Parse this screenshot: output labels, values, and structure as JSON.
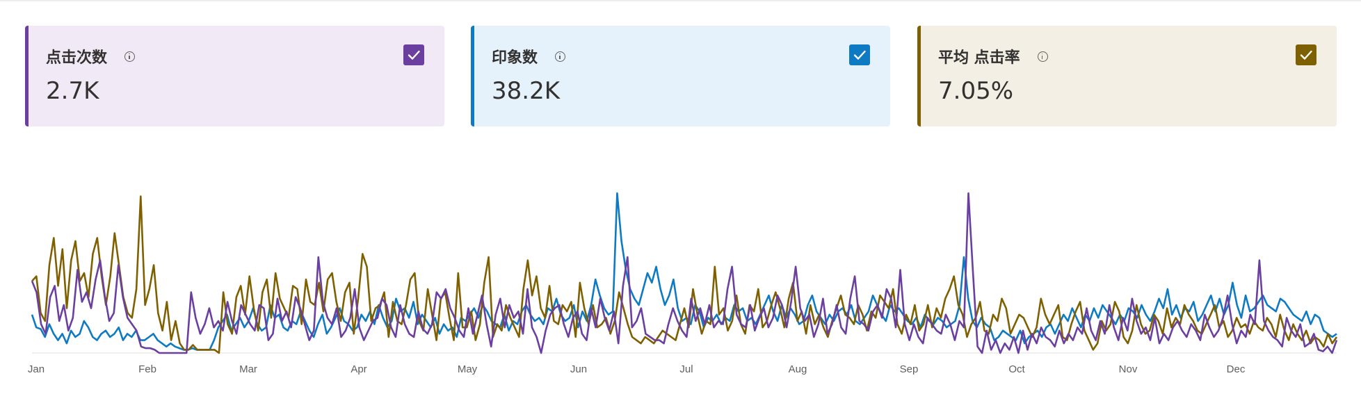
{
  "cards": [
    {
      "title": "点击次数",
      "value": "2.7K",
      "color": "#6b3fa0",
      "bg": "#f1eaf6",
      "icon": "info-icon",
      "checked": true
    },
    {
      "title": "印象数",
      "value": "38.2K",
      "color": "#0e7ac4",
      "bg": "#e6f2fb",
      "icon": "info-icon",
      "checked": true
    },
    {
      "title": "平均 点击率",
      "value": "7.05%",
      "color": "#7f6000",
      "bg": "#f3efe4",
      "icon": "info-icon",
      "checked": true
    }
  ],
  "chart_data": {
    "type": "line",
    "x_ticks": [
      "Jan",
      "Feb",
      "Mar",
      "Apr",
      "May",
      "Jun",
      "Jul",
      "Aug",
      "Sep",
      "Oct",
      "Nov",
      "Dec"
    ],
    "ylim": [
      0,
      100
    ],
    "grid": false,
    "series": [
      {
        "name": "点击次数",
        "color": "#6b3fa0",
        "values": [
          45,
          38,
          18,
          12,
          35,
          42,
          20,
          30,
          14,
          22,
          52,
          32,
          38,
          28,
          46,
          58,
          36,
          20,
          25,
          55,
          35,
          22,
          18,
          14,
          4,
          3,
          3,
          2,
          0,
          0,
          0,
          0,
          0,
          0,
          0,
          38,
          22,
          12,
          18,
          28,
          16,
          20,
          14,
          32,
          20,
          12,
          30,
          24,
          18,
          14,
          30,
          28,
          8,
          12,
          34,
          20,
          26,
          16,
          35,
          28,
          18,
          8,
          14,
          60,
          32,
          22,
          18,
          28,
          10,
          14,
          22,
          40,
          16,
          8,
          14,
          20,
          22,
          34,
          30,
          16,
          10,
          30,
          18,
          12,
          10,
          26,
          15,
          12,
          18,
          38,
          34,
          40,
          28,
          22,
          14,
          10,
          28,
          12,
          24,
          36,
          18,
          4,
          24,
          34,
          16,
          30,
          22,
          26,
          12,
          40,
          16,
          10,
          0,
          14,
          24,
          28,
          30,
          18,
          10,
          22,
          26,
          12,
          8,
          28,
          16,
          34,
          22,
          14,
          26,
          6,
          42,
          60,
          16,
          20,
          28,
          12,
          10,
          8,
          8,
          6,
          18,
          28,
          20,
          14,
          10,
          34,
          20,
          28,
          18,
          30,
          16,
          20,
          18,
          40,
          54,
          24,
          18,
          16,
          30,
          14,
          22,
          28,
          16,
          22,
          36,
          30,
          16,
          32,
          54,
          28,
          20,
          24,
          10,
          18,
          34,
          12,
          18,
          30,
          16,
          12,
          34,
          48,
          20,
          18,
          14,
          26,
          30,
          22,
          40,
          34,
          16,
          52,
          18,
          8,
          18,
          10,
          6,
          22,
          18,
          14,
          12,
          24,
          18,
          8,
          20,
          16,
          100,
          50,
          4,
          0,
          14,
          2,
          8,
          0,
          6,
          2,
          10,
          0,
          14,
          2,
          12,
          6,
          16,
          10,
          8,
          4,
          14,
          6,
          12,
          8,
          16,
          12,
          28,
          14,
          8,
          20,
          12,
          30,
          16,
          8,
          22,
          14,
          34,
          20,
          12,
          16,
          8,
          22,
          6,
          12,
          8,
          16,
          20,
          14,
          10,
          18,
          14,
          8,
          24,
          16,
          10,
          14,
          22,
          36,
          18,
          6,
          14,
          10,
          24,
          18,
          58,
          20,
          14,
          10,
          8,
          4,
          22,
          14,
          10,
          18,
          4,
          6,
          12,
          2,
          1,
          4,
          0,
          8
        ]
      },
      {
        "name": "印象数",
        "color": "#0e7ac4",
        "values": [
          24,
          16,
          15,
          10,
          18,
          12,
          8,
          12,
          6,
          14,
          10,
          12,
          20,
          16,
          10,
          8,
          12,
          14,
          10,
          12,
          16,
          8,
          12,
          10,
          14,
          8,
          8,
          10,
          12,
          8,
          6,
          4,
          6,
          4,
          3,
          2,
          2,
          3,
          2,
          2,
          2,
          2,
          8,
          16,
          20,
          24,
          14,
          18,
          22,
          16,
          20,
          28,
          18,
          14,
          16,
          30,
          22,
          24,
          16,
          14,
          20,
          18,
          26,
          20,
          14,
          10,
          18,
          24,
          12,
          16,
          22,
          28,
          20,
          18,
          14,
          16,
          24,
          20,
          26,
          18,
          30,
          22,
          16,
          20,
          34,
          26,
          28,
          22,
          32,
          18,
          24,
          20,
          16,
          22,
          12,
          18,
          14,
          16,
          10,
          22,
          20,
          24,
          28,
          22,
          30,
          26,
          20,
          18,
          16,
          24,
          14,
          20,
          18,
          26,
          30,
          24,
          20,
          22,
          18,
          28,
          26,
          34,
          24,
          20,
          22,
          30,
          16,
          26,
          20,
          30,
          46,
          36,
          28,
          24,
          26,
          100,
          70,
          52,
          40,
          34,
          30,
          40,
          50,
          44,
          54,
          40,
          30,
          36,
          46,
          28,
          20,
          22,
          18,
          30,
          26,
          16,
          22,
          20,
          24,
          18,
          22,
          20,
          30,
          26,
          28,
          20,
          22,
          18,
          24,
          30,
          36,
          26,
          20,
          30,
          22,
          28,
          24,
          18,
          20,
          30,
          36,
          26,
          22,
          18,
          24,
          20,
          26,
          28,
          24,
          30,
          20,
          18,
          22,
          26,
          36,
          30,
          24,
          20,
          30,
          26,
          28,
          24,
          20,
          18,
          22,
          16,
          24,
          20,
          18,
          22,
          20,
          16,
          18,
          20,
          30,
          60,
          34,
          20,
          16,
          22,
          18,
          16,
          8,
          10,
          14,
          12,
          10,
          8,
          14,
          6,
          10,
          12,
          14,
          10,
          16,
          18,
          12,
          18,
          24,
          20,
          28,
          22,
          16,
          24,
          20,
          28,
          22,
          30,
          26,
          22,
          18,
          24,
          20,
          28,
          26,
          22,
          30,
          24,
          20,
          26,
          34,
          28,
          40,
          24,
          30,
          22,
          28,
          26,
          32,
          20,
          24,
          30,
          36,
          26,
          34,
          24,
          30,
          44,
          30,
          22,
          36,
          26,
          28,
          32,
          36,
          30,
          28,
          26,
          34,
          32,
          28,
          24,
          22,
          20,
          26,
          18,
          24,
          22,
          14,
          12,
          10,
          12
        ]
      },
      {
        "name": "平均 点击率",
        "color": "#7f6000",
        "values": [
          45,
          48,
          25,
          20,
          55,
          72,
          42,
          65,
          28,
          58,
          70,
          45,
          50,
          35,
          62,
          72,
          48,
          30,
          48,
          75,
          55,
          35,
          25,
          22,
          40,
          98,
          30,
          40,
          55,
          25,
          14,
          32,
          8,
          20,
          6,
          2,
          2,
          5,
          2,
          2,
          2,
          2,
          2,
          0,
          38,
          18,
          12,
          35,
          42,
          24,
          48,
          28,
          14,
          38,
          46,
          22,
          50,
          34,
          28,
          22,
          42,
          40,
          18,
          46,
          32,
          30,
          44,
          26,
          46,
          50,
          32,
          20,
          38,
          44,
          12,
          34,
          62,
          54,
          20,
          28,
          30,
          38,
          10,
          32,
          20,
          18,
          30,
          46,
          50,
          20,
          14,
          40,
          24,
          8,
          34,
          38,
          22,
          8,
          50,
          16,
          16,
          26,
          8,
          18,
          44,
          60,
          10,
          18,
          14,
          30,
          22,
          16,
          10,
          40,
          58,
          36,
          48,
          28,
          22,
          42,
          20,
          18,
          30,
          26,
          32,
          10,
          44,
          28,
          18,
          30,
          16,
          18,
          22,
          12,
          20,
          38,
          28,
          18,
          10,
          8,
          6,
          10,
          8,
          6,
          10,
          14,
          12,
          10,
          8,
          18,
          28,
          16,
          40,
          24,
          12,
          20,
          18,
          54,
          24,
          28,
          14,
          20,
          36,
          18,
          12,
          30,
          26,
          40,
          16,
          20,
          30,
          38,
          28,
          16,
          34,
          44,
          20,
          26,
          12,
          30,
          18,
          24,
          16,
          10,
          20,
          28,
          36,
          24,
          22,
          18,
          30,
          24,
          14,
          26,
          22,
          36,
          32,
          28,
          40,
          18,
          12,
          24,
          18,
          30,
          14,
          18,
          30,
          16,
          28,
          22,
          34,
          40,
          48,
          30,
          24,
          10,
          18,
          22,
          32,
          14,
          12,
          24,
          20,
          34,
          28,
          12,
          18,
          24,
          22,
          16,
          10,
          16,
          34,
          24,
          18,
          24,
          30,
          10,
          8,
          18,
          26,
          32,
          14,
          8,
          2,
          6,
          20,
          14,
          18,
          32,
          26,
          10,
          6,
          14,
          30,
          18,
          12,
          14,
          24,
          20,
          12,
          28,
          16,
          22,
          18,
          30,
          24,
          20,
          14,
          12,
          18,
          24,
          30,
          16,
          20,
          10,
          14,
          22,
          16,
          18,
          12,
          20,
          16,
          14,
          22,
          18,
          10,
          24,
          14,
          8,
          18,
          12,
          8,
          14,
          6,
          10,
          8,
          4,
          12,
          6,
          10
        ]
      }
    ]
  }
}
